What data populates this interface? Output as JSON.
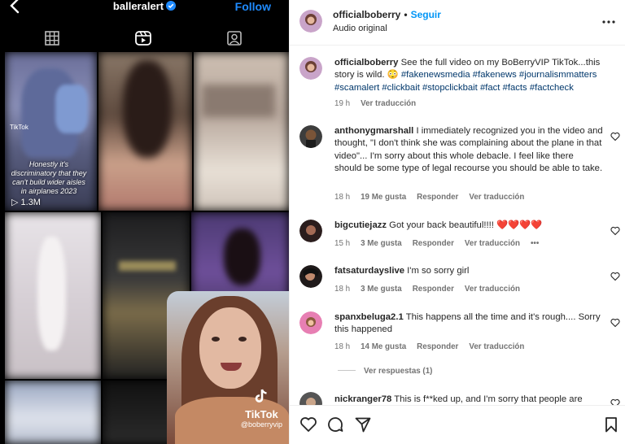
{
  "profile": {
    "username": "balleralert",
    "follow_label": "Follow",
    "tabs": [
      "grid-icon",
      "reels-icon",
      "tagged-icon"
    ]
  },
  "grid": {
    "tile1_caption": "Honestly it's discriminatory that they can't build wider aisles in airplanes 2023",
    "tile1_views": "1.3M",
    "tile1_tiktok": "TikTok"
  },
  "video": {
    "tiktok_label": "TikTok",
    "tiktok_user": "@boberryvip"
  },
  "post": {
    "username": "officialboberry",
    "separator": "•",
    "follow_label": "Seguir",
    "audio": "Audio original"
  },
  "caption": {
    "username": "officialboberry",
    "text": "See the full video on my BoBerryVIP TikTok...this story is wild. 😳",
    "hashtags": "#fakenewsmedia #fakenews #journalismmatters #scamalert #clickbait #stopclickbait #fact #facts #factcheck",
    "time": "19 h",
    "translate": "Ver traducción"
  },
  "comments": [
    {
      "username": "anthonygmarshall",
      "text": "I immediately recognized you in the video and thought, \"I don't think she was complaining about the plane in that video\"... I'm sorry about this whole debacle. I feel like there should be some type of legal recourse you should be able to take.",
      "time": "18 h",
      "likes": "19 Me gusta",
      "reply": "Responder",
      "translate": "Ver traducción"
    },
    {
      "username": "bigcutiejazz",
      "text": "Got your back beautiful!!!! ❤️❤️❤️❤️",
      "time": "15 h",
      "likes": "3 Me gusta",
      "reply": "Responder",
      "translate": "Ver traducción",
      "more": "•••"
    },
    {
      "username": "fatsaturdayslive",
      "text": "I'm so sorry girl",
      "time": "18 h",
      "likes": "3 Me gusta",
      "reply": "Responder",
      "translate": "Ver traducción"
    },
    {
      "username": "spanxbeluga2.1",
      "text": "This happens all the time and it's rough.... Sorry this happened",
      "time": "18 h",
      "likes": "14 Me gusta",
      "reply": "Responder",
      "translate": "Ver traducción"
    },
    {
      "username": "nickranger78",
      "text": "This is f**ked up, and I'm sorry that people are"
    }
  ],
  "view_replies": "Ver respuestas (1)",
  "colors": {
    "link_blue": "#0095f6",
    "hashtag": "#00376b",
    "meta_gray": "#737373"
  },
  "icons": {
    "actions": [
      "heart-icon",
      "comment-icon",
      "share-icon",
      "save-icon"
    ],
    "more": "more-horizontal-icon"
  }
}
